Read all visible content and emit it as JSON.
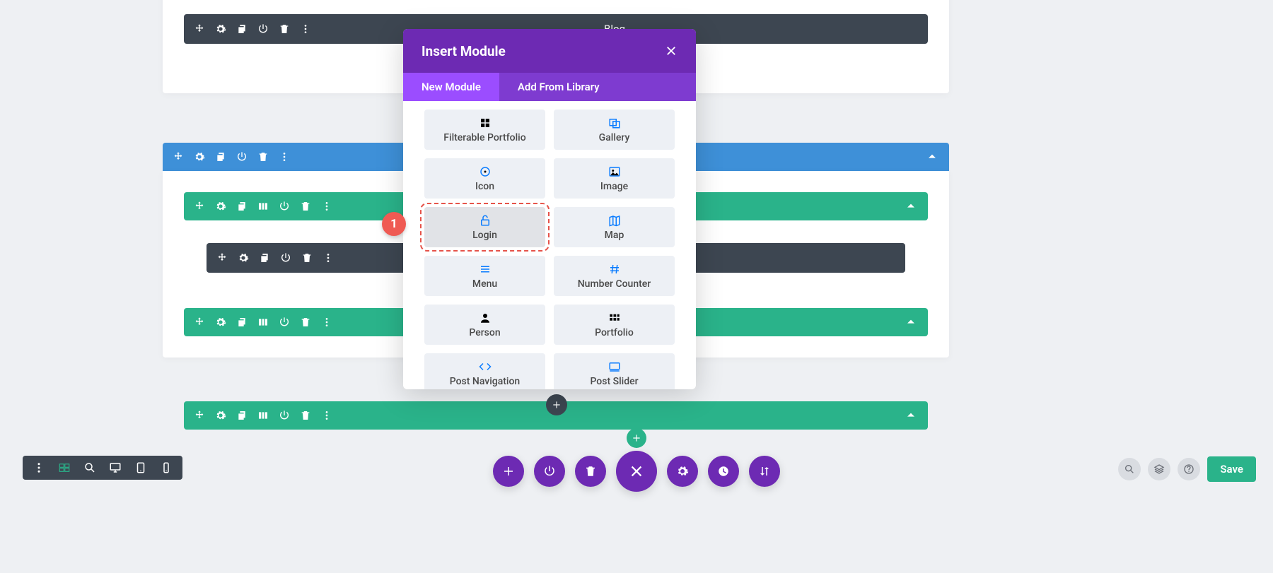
{
  "sections": {
    "blog_label": "Blog"
  },
  "modal": {
    "title": "Insert Module",
    "tabs": {
      "new": "New Module",
      "lib": "Add From Library"
    },
    "items": [
      {
        "icon": "grid4",
        "label": "Filterable Portfolio"
      },
      {
        "icon": "gallery",
        "label": "Gallery"
      },
      {
        "icon": "target",
        "label": "Icon"
      },
      {
        "icon": "image",
        "label": "Image"
      },
      {
        "icon": "lock",
        "label": "Login",
        "hl": true
      },
      {
        "icon": "map",
        "label": "Map"
      },
      {
        "icon": "menu",
        "label": "Menu"
      },
      {
        "icon": "hash",
        "label": "Number Counter"
      },
      {
        "icon": "person",
        "label": "Person"
      },
      {
        "icon": "grid6",
        "label": "Portfolio"
      },
      {
        "icon": "code",
        "label": "Post Navigation"
      },
      {
        "icon": "slider",
        "label": "Post Slider"
      }
    ]
  },
  "callout": "1",
  "save": "Save",
  "bubble_icons": [
    "plus",
    "power",
    "trash",
    "close",
    "gear",
    "history",
    "sort"
  ],
  "left_toolbar": [
    "dots",
    "wire",
    "zoom",
    "desktop",
    "tablet",
    "phone"
  ],
  "right_round": [
    "zoom",
    "layers",
    "help"
  ],
  "colors": {
    "purple": "#6d2ab3",
    "green": "#2ab38a",
    "blue": "#3e90d8",
    "red": "#ef5a53"
  }
}
